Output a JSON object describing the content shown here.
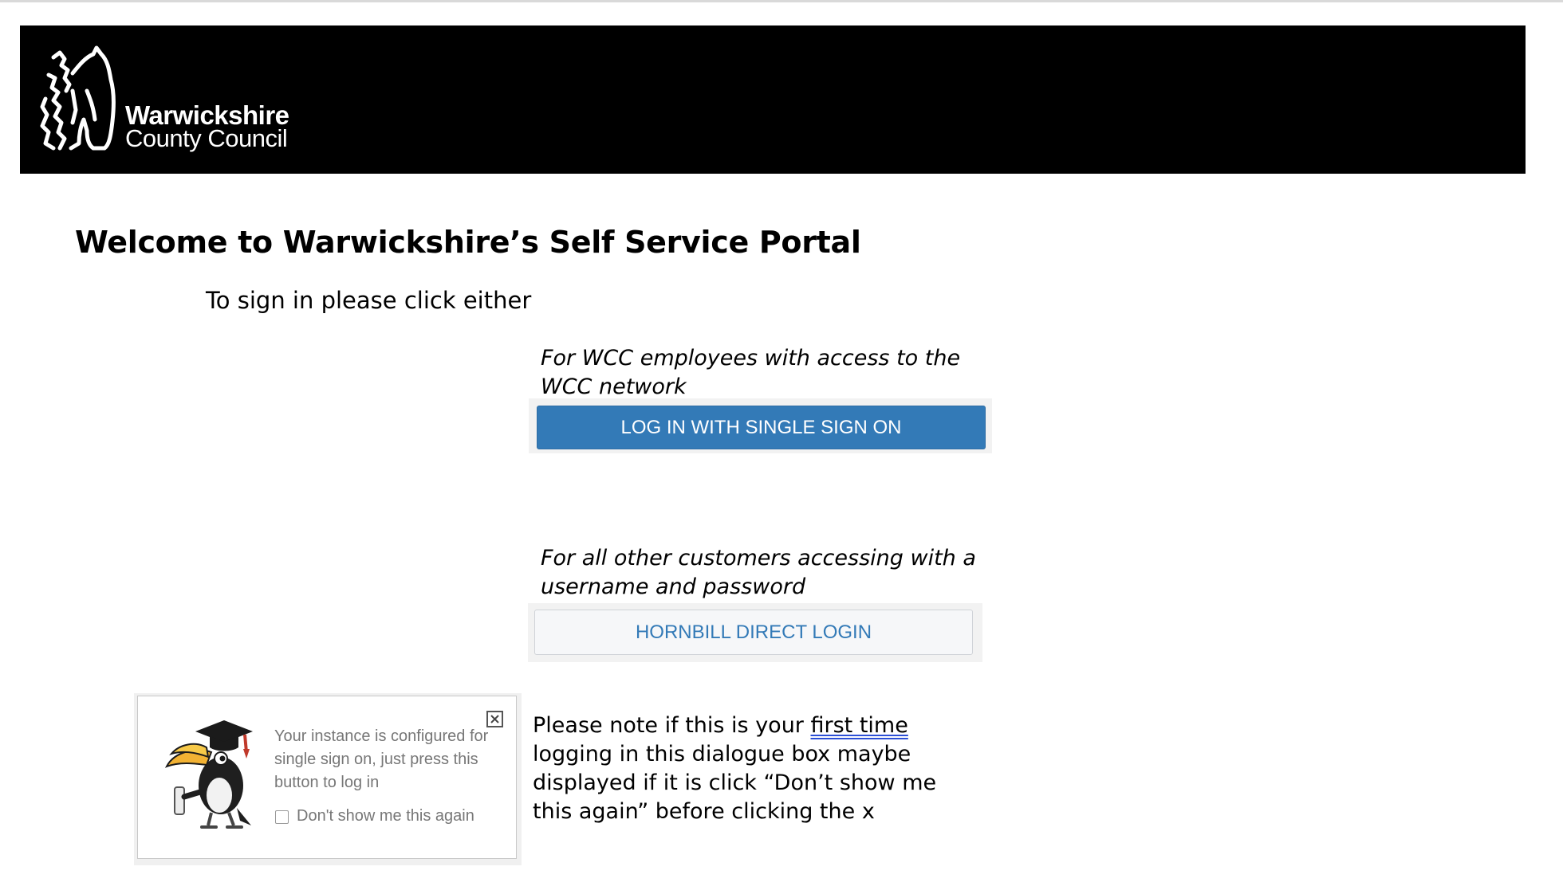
{
  "brand": {
    "line1": "Warwickshire",
    "line2": "County Council",
    "banner_color": "#000000"
  },
  "page": {
    "title": "Welcome to Warwickshire’s Self Service Portal",
    "intro": "To sign in please click either"
  },
  "sso": {
    "note": "For WCC employees with access to the WCC network",
    "button_label": "LOG IN WITH SINGLE SIGN ON",
    "button_color": "#337ab7"
  },
  "direct": {
    "note": "For all other customers accessing with a username and password",
    "button_label": "HORNBILL DIRECT LOGIN"
  },
  "dialog": {
    "message": "Your instance is configured for single sign on, just press this button to log in",
    "checkbox_label": "Don't show me this again",
    "checkbox_checked": false,
    "close_icon": "close-box-icon",
    "mascot_icon": "hornbill-graduate-icon"
  },
  "note": {
    "part1": "Please note if this is your ",
    "underlined": "first time",
    "part2": " logging in this dialogue box maybe displayed if it is click “Don’t show me this again” before clicking the x"
  }
}
